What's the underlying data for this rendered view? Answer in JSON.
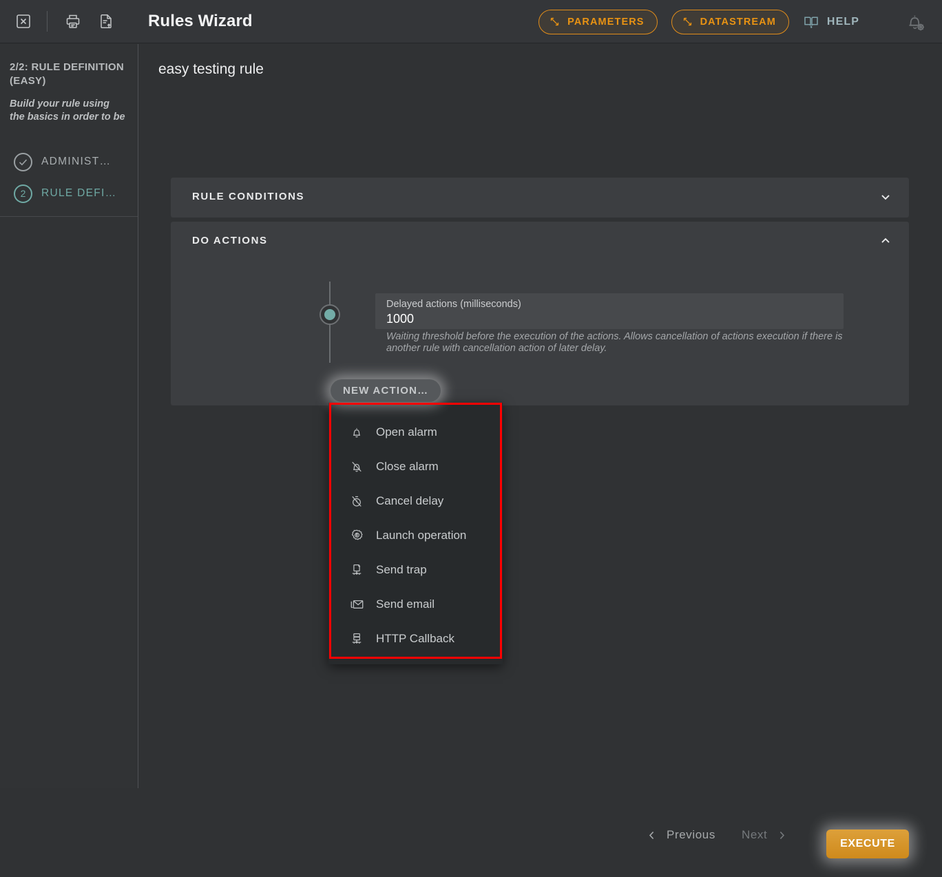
{
  "topbar": {
    "close_icon": "close-box-icon",
    "print_icon": "printer-icon",
    "export_icon": "document-upload-icon",
    "title": "Rules Wizard",
    "parameters_label": "PARAMETERS",
    "datastream_label": "DATASTREAM",
    "help_label": "HELP",
    "notification_icon": "bell-gear-icon",
    "accent_orange": "#e99313",
    "help_teal": "#9fb5bb"
  },
  "sidebar": {
    "title": "2/2: RULE DEFINITION (EASY)",
    "description": "Build your rule using the basics in order to be",
    "steps": [
      {
        "marker": "✓",
        "label": "ADMINIST…",
        "active": false
      },
      {
        "marker": "2",
        "label": "RULE DEFI…",
        "active": true
      }
    ]
  },
  "main": {
    "rule_name": "easy testing rule",
    "panels": [
      {
        "title": "RULE CONDITIONS",
        "expanded": false,
        "chevron": "chevron-down-icon"
      },
      {
        "title": "DO ACTIONS",
        "expanded": true,
        "chevron": "chevron-up-icon"
      }
    ],
    "delayed_action": {
      "label": "Delayed actions (milliseconds)",
      "value": "1000",
      "help": "Waiting threshold before the execution of the actions. Allows cancellation of actions execution if there is another rule with cancellation action of later delay."
    },
    "new_action_label": "NEW ACTION…",
    "action_menu": [
      {
        "icon": "bell-icon",
        "label": "Open alarm"
      },
      {
        "icon": "bell-off-icon",
        "label": "Close alarm"
      },
      {
        "icon": "timer-off-icon",
        "label": "Cancel delay"
      },
      {
        "icon": "gear-icon",
        "label": "Launch operation"
      },
      {
        "icon": "send-trap-icon",
        "label": "Send trap"
      },
      {
        "icon": "envelope-icon",
        "label": "Send email"
      },
      {
        "icon": "server-icon",
        "label": "HTTP Callback"
      }
    ]
  },
  "footer": {
    "previous_label": "Previous",
    "next_label": "Next",
    "execute_label": "EXECUTE"
  }
}
